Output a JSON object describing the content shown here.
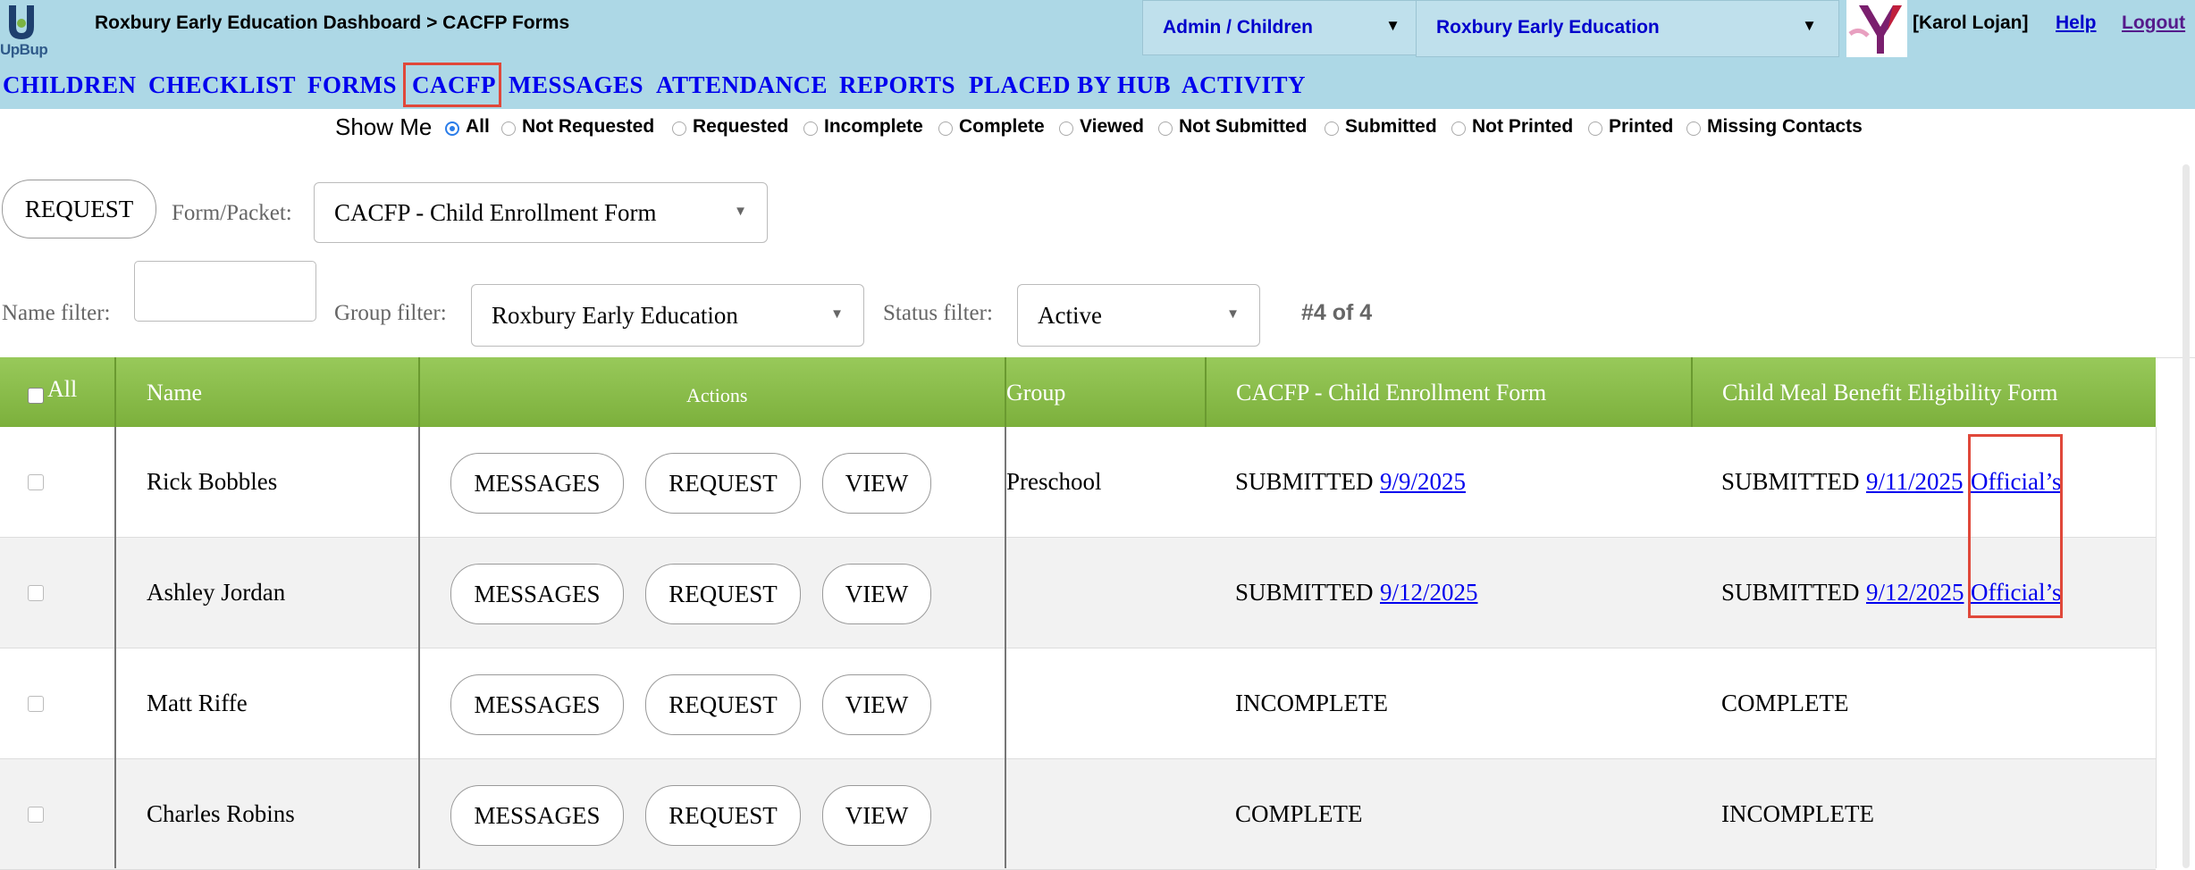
{
  "header": {
    "logo_text": "UpBup",
    "breadcrumb": "Roxbury Early Education Dashboard > CACFP Forms",
    "role_select": "Admin / Children",
    "org_select": "Roxbury Early Education",
    "user": "[Karol Lojan]",
    "help": "Help",
    "logout": "Logout"
  },
  "nav": {
    "items": [
      "CHILDREN",
      "CHECKLIST",
      "FORMS",
      "CACFP",
      "MESSAGES",
      "ATTENDANCE",
      "REPORTS",
      "PLACED BY HUB",
      "ACTIVITY"
    ],
    "active": "CACFP"
  },
  "show_me": {
    "label": "Show Me",
    "options": [
      "All",
      "Not Requested",
      "Requested",
      "Incomplete",
      "Complete",
      "Viewed",
      "Not Submitted",
      "Submitted",
      "Not Printed",
      "Printed",
      "Missing Contacts"
    ],
    "selected": "All"
  },
  "controls": {
    "request_button": "REQUEST",
    "form_packet_label": "Form/Packet:",
    "form_packet_value": "CACFP - Child Enrollment Form",
    "name_filter_label": "Name filter:",
    "name_filter_value": "",
    "group_filter_label": "Group filter:",
    "group_filter_value": "Roxbury Early Education",
    "status_filter_label": "Status filter:",
    "status_filter_value": "Active",
    "count": "#4 of 4"
  },
  "table": {
    "headers": {
      "all": "All",
      "name": "Name",
      "actions": "Actions",
      "group": "Group",
      "form1": "CACFP - Child Enrollment Form",
      "form2": "Child Meal Benefit Eligibility Form"
    },
    "action_labels": {
      "messages": "MESSAGES",
      "request": "REQUEST",
      "view": "VIEW"
    },
    "rows": [
      {
        "name": "Rick Bobbles",
        "group": "Preschool",
        "form1_status": "SUBMITTED",
        "form1_date": "9/9/2025",
        "form2_status": "SUBMITTED",
        "form2_date": "9/11/2025",
        "form2_link": "Official’s"
      },
      {
        "name": "Ashley Jordan",
        "group": "",
        "form1_status": "SUBMITTED",
        "form1_date": "9/12/2025",
        "form2_status": "SUBMITTED",
        "form2_date": "9/12/2025",
        "form2_link": "Official’s"
      },
      {
        "name": "Matt Riffe",
        "group": "",
        "form1_status": "INCOMPLETE",
        "form1_date": "",
        "form2_status": "COMPLETE",
        "form2_date": "",
        "form2_link": ""
      },
      {
        "name": "Charles Robins",
        "group": "",
        "form1_status": "COMPLETE",
        "form1_date": "",
        "form2_status": "INCOMPLETE",
        "form2_date": "",
        "form2_link": ""
      }
    ]
  },
  "colors": {
    "header_bg": "#add8e6",
    "nav_link": "#0000ee",
    "table_header": "#8cbf4c",
    "highlight": "#e0483a",
    "radio_selected": "#2b7de9"
  }
}
